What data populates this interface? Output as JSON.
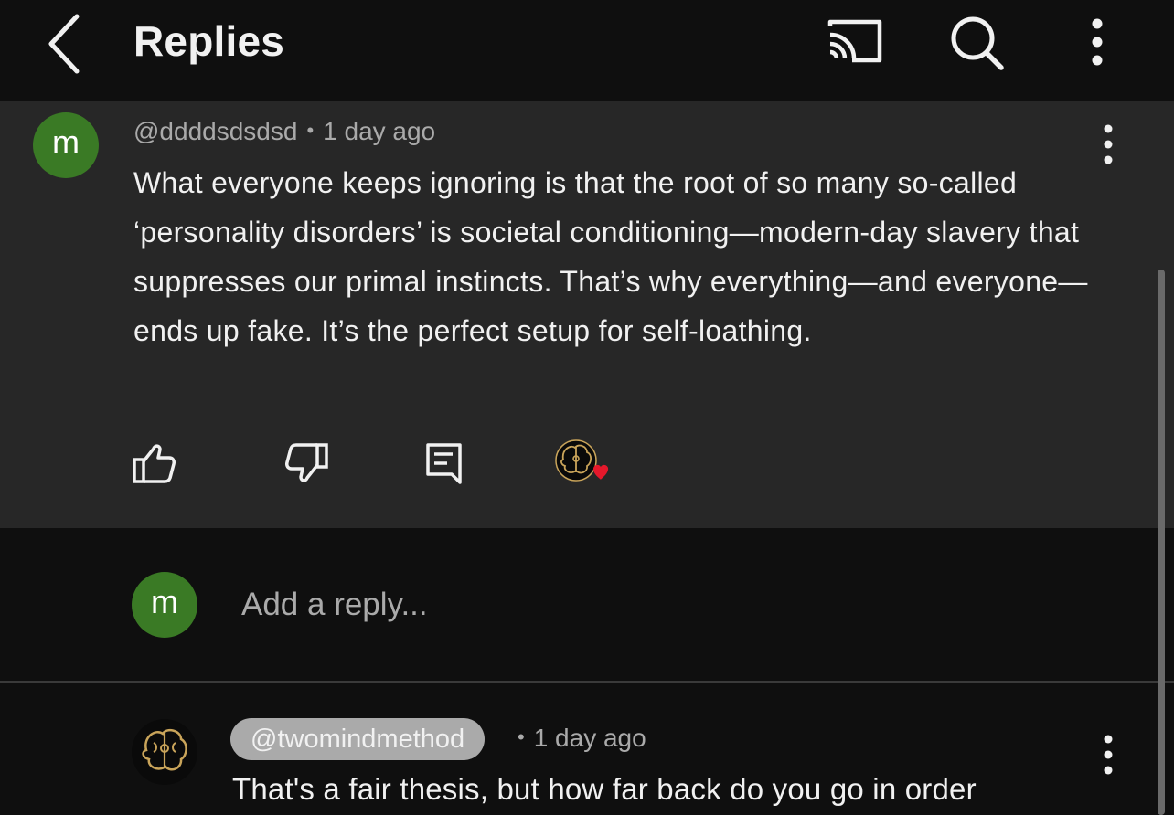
{
  "header": {
    "title": "Replies",
    "icons": [
      "back-chevron-icon",
      "cast-icon",
      "search-icon",
      "more-vert-icon"
    ]
  },
  "parent_comment": {
    "avatar_letter": "m",
    "avatar_color": "#3a7a25",
    "handle": "@ddddsdsdsd",
    "separator": "•",
    "time": "1 day ago",
    "text": "What everyone keeps ignoring is that the root of so many so-called ‘personality disorders’ is societal conditioning—modern-day slavery that suppresses our primal instincts. That’s why everything—and everyone—ends up fake. It’s the perfect setup for self-loathing.",
    "actions": [
      "like-icon",
      "dislike-icon",
      "reply-icon",
      "creator-heart-icon"
    ]
  },
  "add_reply": {
    "avatar_letter": "m",
    "placeholder": "Add a reply..."
  },
  "reply": {
    "handle": "@twomindmethod",
    "separator": "•",
    "time": "1 day ago",
    "text": "That's a fair thesis, but how far back do you go in order"
  },
  "colors": {
    "background": "#0f0f0f",
    "parent_bg": "#272727",
    "heart": "#e5182b",
    "avatar_green": "#3a7a25",
    "chip_bg": "#aaaaaa",
    "brain_gold": "#c9a45a"
  }
}
